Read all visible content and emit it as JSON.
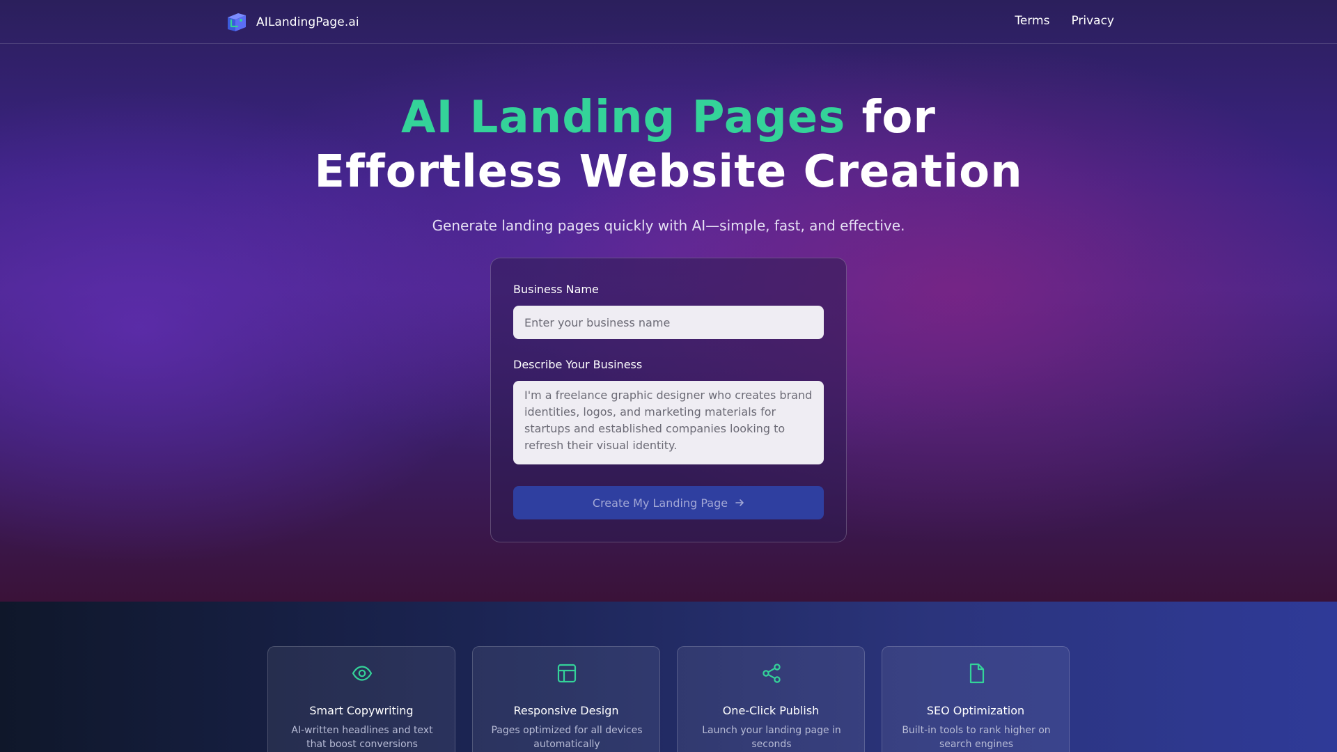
{
  "nav": {
    "brand_name": "AILandingPage.ai",
    "links": [
      "Terms",
      "Privacy"
    ]
  },
  "hero": {
    "headline_accent": "AI Landing Pages",
    "headline_rest": " for",
    "headline_line2": "Effortless Website Creation",
    "subtitle": "Generate landing pages quickly with AI—simple, fast, and effective."
  },
  "form": {
    "business_name_label": "Business Name",
    "business_name_placeholder": "Enter your business name",
    "business_name_value": "",
    "description_label": "Describe Your Business",
    "description_placeholder": "I'm a freelance graphic designer who creates brand identities, logos, and marketing materials for startups and established companies looking to refresh their visual identity.",
    "description_value": "",
    "submit_label": "Create My Landing Page",
    "submit_icon": "arrow-right-icon"
  },
  "features": [
    {
      "icon": "eye-icon",
      "title": "Smart Copywriting",
      "description": "AI-written headlines and text that boost conversions"
    },
    {
      "icon": "layout-icon",
      "title": "Responsive Design",
      "description": "Pages optimized for all devices automatically"
    },
    {
      "icon": "share-icon",
      "title": "One-Click Publish",
      "description": "Launch your landing page in seconds"
    },
    {
      "icon": "file-icon",
      "title": "SEO Optimization",
      "description": "Built-in tools to rank higher on search engines"
    }
  ],
  "colors": {
    "accent_green": "#34d399",
    "button_blue": "#2f3fa0",
    "hero_purple": "#48268a"
  }
}
